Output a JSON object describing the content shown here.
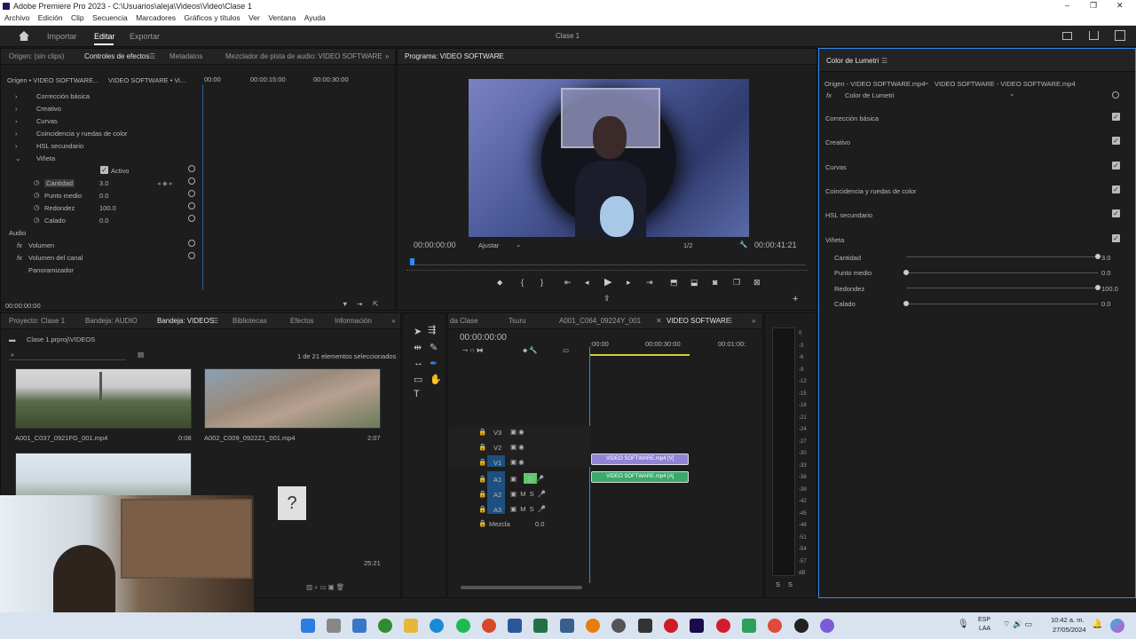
{
  "window": {
    "title": "Adobe Premiere Pro 2023 - C:\\Usuarios\\aleja\\Videos\\Video\\Clase 1",
    "controls": [
      "–",
      "❐",
      "✕"
    ]
  },
  "menu": [
    "Archivo",
    "Edición",
    "Clip",
    "Secuencia",
    "Marcadores",
    "Gráficos y títulos",
    "Ver",
    "Ventana",
    "Ayuda"
  ],
  "appbar": {
    "tabs": [
      "Importar",
      "Editar",
      "Exportar"
    ],
    "project": "Clase 1"
  },
  "effect_controls": {
    "tabs": [
      "Origen: (sin clips)",
      "Controles de efectos",
      "Metadatos",
      "Mezclador de pista de audio: VIDEO SOFTWARE"
    ],
    "source": "Origen • VIDEO SOFTWARE...",
    "sequence": "VIDEO SOFTWARE • Vi...",
    "ruler": [
      "00:00",
      "00:00:15:00",
      "00:00:30:00"
    ],
    "sections": [
      "Corrección básica",
      "Creativo",
      "Curvas",
      "Coincidencia y ruedas de color",
      "HSL secundario",
      "Viñeta"
    ],
    "active_label": "Activo",
    "params": [
      {
        "name": "Cantidad",
        "value": "3.0"
      },
      {
        "name": "Punto medio",
        "value": "0.0"
      },
      {
        "name": "Redondez",
        "value": "100.0"
      },
      {
        "name": "Calado",
        "value": "0.0"
      }
    ],
    "audio_label": "Audio",
    "audio_items": [
      "Volumen",
      "Volumen del canal",
      "Panoramizador"
    ],
    "timecode": "00:00:00:00"
  },
  "program": {
    "title": "Programa: VIDEO SOFTWARE",
    "timecode": "00:00:00:00",
    "fit": "Ajustar",
    "ratio": "1/2",
    "duration": "00:00:41:21"
  },
  "lumetri": {
    "title": "Color de Lumetri",
    "source": "Origen - VIDEO SOFTWARE.mp4",
    "sequence": "VIDEO SOFTWARE - VIDEO SOFTWARE.mp4",
    "effect": "Color de Lumetri",
    "sections": [
      "Corrección básica",
      "Creativo",
      "Curvas",
      "Coincidencia y ruedas de color",
      "HSL secundario",
      "Viñeta"
    ],
    "params": [
      {
        "name": "Cantidad",
        "value": "3.0",
        "level": 1.0
      },
      {
        "name": "Punto medio",
        "value": "0.0",
        "level": 0.0
      },
      {
        "name": "Redondez",
        "value": "100.0",
        "level": 1.0
      },
      {
        "name": "Calado",
        "value": "0.0",
        "level": 0.0
      }
    ]
  },
  "project": {
    "tabs": [
      "Proyecto: Clase 1",
      "Bandeja: AUDIO",
      "Bandeja: VIDEOS",
      "Bibliotecas",
      "Efectos",
      "Información"
    ],
    "path": "Clase 1.prproj\\VIDEOS",
    "count": "1 de 21 elementos seleccionados",
    "clips": [
      {
        "name": "A001_C037_0921FG_001.mp4",
        "duration": "0:08"
      },
      {
        "name": "A002_C009_0922Z1_001.mp4",
        "duration": "2:07"
      }
    ],
    "extra_duration": "25:21"
  },
  "timeline": {
    "tabs": [
      "da Clase",
      "Tsuru",
      "A001_C064_09224Y_001",
      "VIDEO SOFTWARE"
    ],
    "timecode": "00:00:00:00",
    "ruler": [
      ":00:00",
      "00:00:30:00",
      "00:01:00:"
    ],
    "video_tracks": [
      "V3",
      "V2",
      "V1"
    ],
    "audio_tracks": [
      "A1",
      "A2",
      "A3"
    ],
    "mix_label": "Mezcla",
    "mix_value": "0.0",
    "video_clip": "VIDEO SOFTWARE.mp4 [V]",
    "audio_clip": "VIDEO SOFTWARE.mp4 [A]"
  },
  "meter": {
    "marks": [
      "0",
      "-3",
      "-6",
      "-9",
      "-12",
      "-15",
      "-18",
      "-21",
      "-24",
      "-27",
      "-30",
      "-33",
      "-36",
      "-39",
      "-42",
      "-45",
      "-48",
      "-51",
      "-54",
      "-57",
      "dB"
    ],
    "solo": [
      "S",
      "S"
    ]
  },
  "taskbar": {
    "lang": "ESP",
    "lang2": "LAA",
    "time": "10:42 a. m.",
    "date": "27/05/2024"
  }
}
